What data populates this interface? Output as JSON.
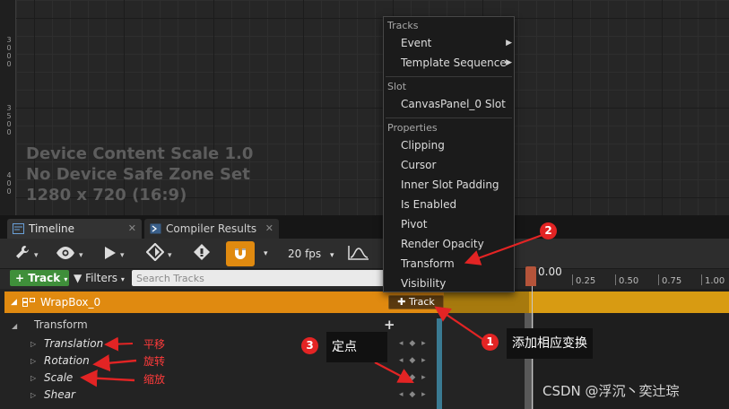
{
  "designer": {
    "scale_line1": "Device Content Scale 1.0",
    "scale_line2": "No Device Safe Zone Set",
    "scale_line3": "1280 x 720 (16:9)",
    "ruler_labels": [
      "3",
      "0",
      "0",
      "0",
      "3",
      "5",
      "0",
      "0",
      "4",
      "0",
      "0"
    ]
  },
  "tabs": [
    {
      "label": "Timeline",
      "close": "✕"
    },
    {
      "label": "Compiler Results",
      "close": "✕"
    }
  ],
  "toolbar": {
    "fps": "20 fps",
    "caret": "▾"
  },
  "filter_row": {
    "add_track": "Track",
    "filters": "Filters",
    "search_placeholder": "Search Tracks"
  },
  "time_ruler": {
    "current": "0.00",
    "labels": [
      "0.25",
      "0.50",
      "0.75",
      "1.00"
    ]
  },
  "tracks": {
    "wrapbox": "WrapBox_0",
    "track_button": "Track",
    "transform": "Transform",
    "children": [
      "Translation",
      "Rotation",
      "Scale",
      "Shear"
    ],
    "keyframe_controls": "◂ ◆ ▸"
  },
  "context_menu": {
    "sections": [
      {
        "header": "Tracks",
        "items": [
          {
            "label": "Event",
            "submenu": true
          },
          {
            "label": "Template Sequence",
            "submenu": true
          }
        ]
      },
      {
        "header": "Slot",
        "items": [
          {
            "label": "CanvasPanel_0 Slot",
            "submenu": false
          }
        ]
      },
      {
        "header": "Properties",
        "items": [
          {
            "label": "Clipping",
            "submenu": false
          },
          {
            "label": "Cursor",
            "submenu": false
          },
          {
            "label": "Inner Slot Padding",
            "submenu": false
          },
          {
            "label": "Is Enabled",
            "submenu": false
          },
          {
            "label": "Pivot",
            "submenu": false
          },
          {
            "label": "Render Opacity",
            "submenu": false
          },
          {
            "label": "Transform",
            "submenu": false
          },
          {
            "label": "Visibility",
            "submenu": false
          }
        ]
      }
    ]
  },
  "annotations": {
    "badge1": "1",
    "badge2": "2",
    "badge3": "3",
    "note_add_transform": "添加相应变换",
    "note_keyframe": "定点",
    "label_translation": "平移",
    "label_rotation": "旋转",
    "label_scale": "缩放",
    "watermark": "CSDN @浮沉丶奕辻琮"
  },
  "colors": {
    "accent_orange": "#e08a10",
    "add_green": "#3f8f3a",
    "annotation_red": "#e32424"
  }
}
